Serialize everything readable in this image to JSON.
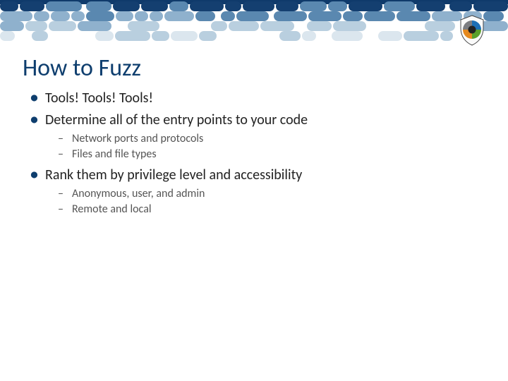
{
  "title": "How to Fuzz",
  "bullets": [
    {
      "text": "Tools! Tools! Tools!",
      "sub": []
    },
    {
      "text": "Determine all of the entry points to your code",
      "sub": [
        "Network ports and protocols",
        "Files and file types"
      ]
    },
    {
      "text": "Rank them by privilege level and accessibility",
      "sub": [
        "Anonymous, user, and admin",
        "Remote and local"
      ]
    }
  ],
  "deco": {
    "colors": {
      "dark": "#143f70",
      "mid": "#5a88b0",
      "light": "#8fb1cd",
      "pale": "#b9cfdf",
      "faint": "#dbe6ee"
    }
  },
  "logo": {
    "ring_colors": [
      "#1c6fb6",
      "#e68a1f",
      "#5aa02b",
      "#7c7d81"
    ],
    "center": "#222"
  }
}
